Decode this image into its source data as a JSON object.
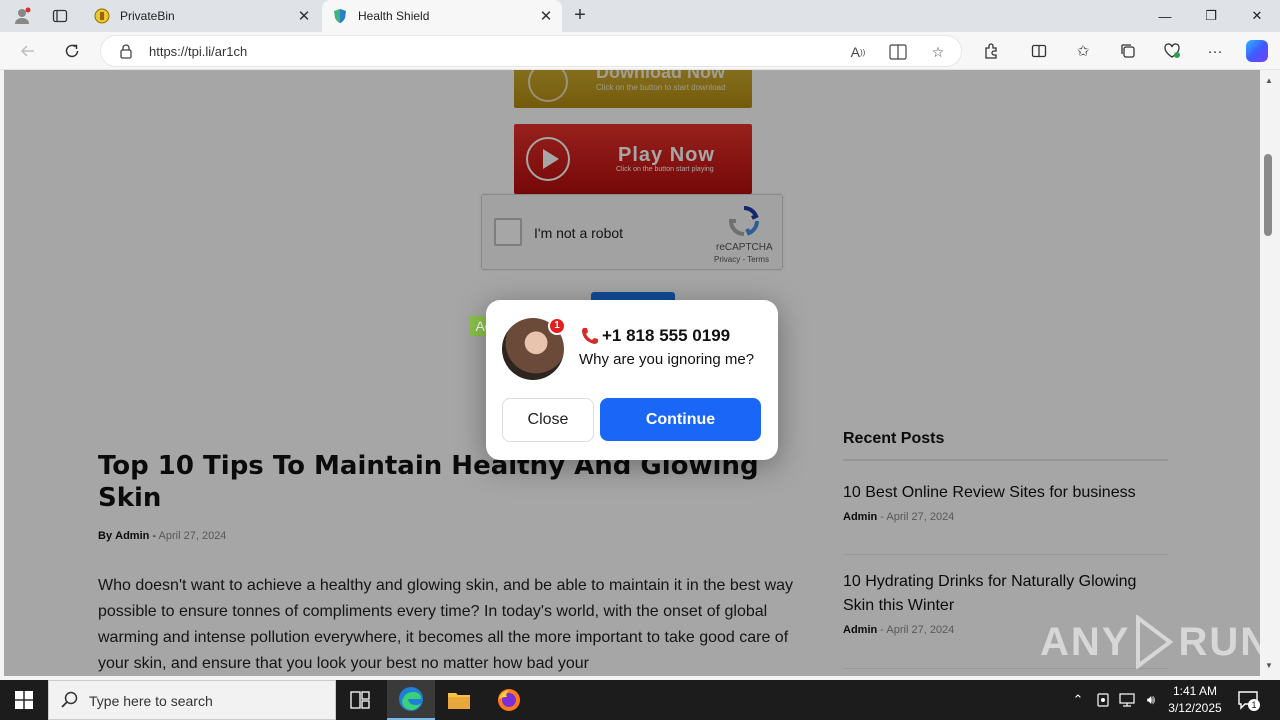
{
  "browser": {
    "tabs": [
      {
        "title": "PrivateBin",
        "active": false
      },
      {
        "title": "Health Shield",
        "active": true
      }
    ],
    "url": "https://tpi.li/ar1ch",
    "window_controls": {
      "minimize": "—",
      "restore": "❐",
      "close": "✕"
    }
  },
  "page": {
    "download_banner": {
      "label": "Download Now",
      "sub": "Click on the button to start download"
    },
    "play_banner": {
      "label": "Play Now",
      "sub": "Click on the button start playing"
    },
    "recaptcha": {
      "label": "I'm not a robot",
      "brand": "reCAPTCHA",
      "links": "Privacy - Terms"
    },
    "article": {
      "title": "Top 10 Tips To Maintain Healthy And Glowing Skin",
      "by": "By",
      "author": "Admin",
      "separator": "-",
      "date": "April 27, 2024",
      "body": "Who doesn't want to achieve a healthy and glowing skin, and be able to maintain it in the best way possible to ensure tonnes of compliments every time? In today's world, with the onset of global warming and intense pollution everywhere, it becomes all the more important to take good care of your skin, and ensure that you look your best no matter how bad your"
    },
    "sidebar": {
      "title": "Recent Posts",
      "posts": [
        {
          "title": "10 Best Online Review Sites for business",
          "author": "Admin",
          "separator": "-",
          "date": "April 27, 2024"
        },
        {
          "title": "10 Hydrating Drinks for Naturally Glowing Skin this Winter",
          "author": "Admin",
          "separator": "-",
          "date": "April 27, 2024"
        }
      ]
    }
  },
  "popup": {
    "ad_tag": "Ad",
    "badge_count": "1",
    "phone": "+1 818 555 0199",
    "message": "Why are you ignoring me?",
    "close_label": "Close",
    "continue_label": "Continue"
  },
  "watermark": {
    "left": "ANY",
    "right": "RUN"
  },
  "taskbar": {
    "search_placeholder": "Type here to search",
    "time": "1:41 AM",
    "date": "3/12/2025",
    "notification_count": "1"
  },
  "colors": {
    "continue_button": "#1a66f6",
    "ad_tag": "#8bc34a",
    "badge": "#e41e1e"
  }
}
